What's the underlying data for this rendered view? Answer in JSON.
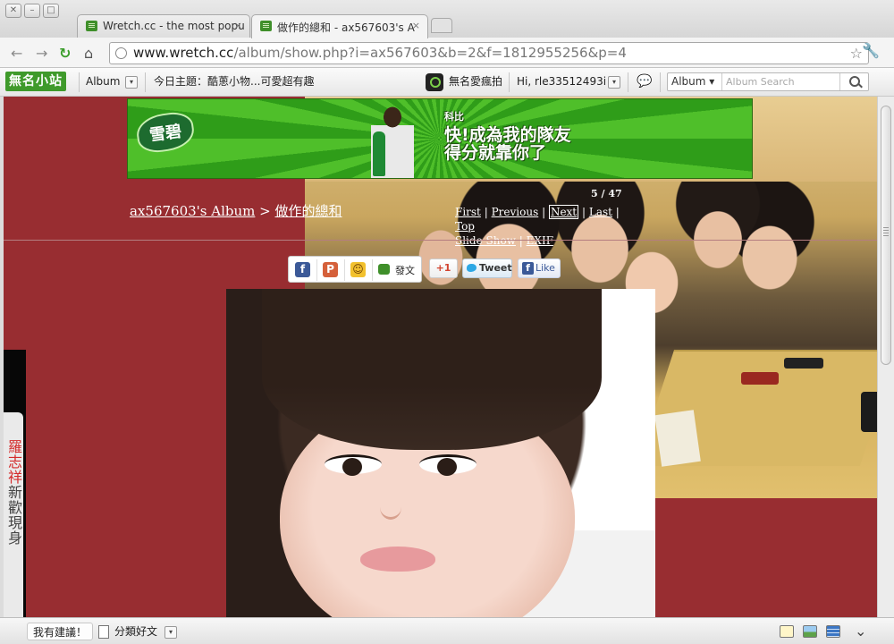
{
  "browser": {
    "window_buttons": [
      "✕",
      "–",
      "□"
    ],
    "tabs": [
      {
        "title": "Wretch.cc - the most popu",
        "close": "×",
        "active": false
      },
      {
        "title": "做作的總和 - ax567603's A",
        "close": "×",
        "active": true
      }
    ],
    "url_host": "www.wretch.cc",
    "url_path": "/album/show.php?i=ax567603&b=2&f=1812955256&p=4",
    "nav": {
      "back": "←",
      "forward": "→",
      "reload": "↻",
      "home": "⌂",
      "bookmark": "☆",
      "menu": "🔧"
    }
  },
  "sitebar": {
    "logo": "無名小站",
    "album_menu": "Album",
    "dropdown_glyph": "▾",
    "topic": "今日主題：酷蔥小物...可愛超有趣",
    "app_label": "無名愛瘋拍",
    "greeting": "Hi, rle33512493i",
    "chat_glyph": "💬",
    "search_category": "Album ▾",
    "search_placeholder": "Album Search"
  },
  "banner": {
    "brand": "雪碧",
    "line0": "科比",
    "line1": "快!成為我的隊友",
    "line2": "得分就靠你了"
  },
  "breadcrumb": {
    "album": "ax567603's Album",
    "separator": ">",
    "current": "做作的總和"
  },
  "pager": {
    "counter": "5 / 47",
    "links": [
      "First",
      "Previous",
      "Next",
      "Last",
      "Top"
    ],
    "links2": [
      "Slide Show",
      "EXIF"
    ],
    "separator": "|"
  },
  "share": {
    "facebook_glyph": "f",
    "plurk_glyph": "P",
    "yahoo_glyph": "☺",
    "post_label": "發文",
    "gplus": "+1",
    "tweet": "Tweet",
    "like": "Like"
  },
  "left_ad": {
    "name": "羅志祥",
    "text": "新歡現身"
  },
  "bottombar": {
    "suggest": "我有建議！",
    "classify": "分類好文",
    "chevron": "⌄"
  }
}
